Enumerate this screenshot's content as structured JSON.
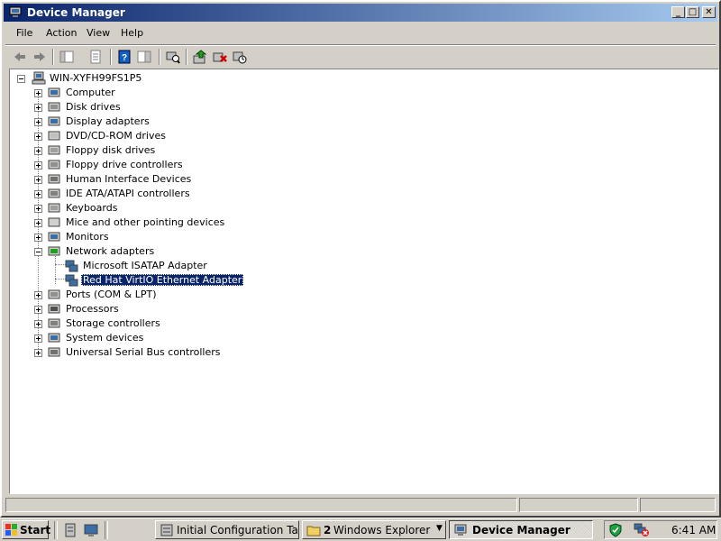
{
  "window": {
    "title": "Device Manager",
    "controls": {
      "minimize": "_",
      "maximize": "□",
      "close": "✕"
    }
  },
  "menu": [
    "File",
    "Action",
    "View",
    "Help"
  ],
  "toolbar": [
    "back-icon",
    "forward-icon",
    "show-hide-console-tree-icon",
    "properties-icon",
    "help-icon",
    "action-pane-icon",
    "scan-hardware-icon",
    "update-driver-icon",
    "uninstall-icon",
    "disable-device-icon"
  ],
  "tree": {
    "root": "WIN-XYFH99FS1P5",
    "categories": [
      {
        "label": "Computer",
        "icon": "computer-icon"
      },
      {
        "label": "Disk drives",
        "icon": "disk-drive-icon"
      },
      {
        "label": "Display adapters",
        "icon": "display-adapter-icon"
      },
      {
        "label": "DVD/CD-ROM drives",
        "icon": "dvd-drive-icon"
      },
      {
        "label": "Floppy disk drives",
        "icon": "floppy-drive-icon"
      },
      {
        "label": "Floppy drive controllers",
        "icon": "floppy-controller-icon"
      },
      {
        "label": "Human Interface Devices",
        "icon": "hid-icon"
      },
      {
        "label": "IDE ATA/ATAPI controllers",
        "icon": "ide-controller-icon"
      },
      {
        "label": "Keyboards",
        "icon": "keyboard-icon"
      },
      {
        "label": "Mice and other pointing devices",
        "icon": "mouse-icon"
      },
      {
        "label": "Monitors",
        "icon": "monitor-icon"
      },
      {
        "label": "Network adapters",
        "icon": "network-adapter-icon",
        "expanded": true,
        "children": [
          "Microsoft ISATAP Adapter",
          "Red Hat VirtIO Ethernet Adapter"
        ],
        "selected_child": 1
      },
      {
        "label": "Ports (COM & LPT)",
        "icon": "port-icon"
      },
      {
        "label": "Processors",
        "icon": "processor-icon"
      },
      {
        "label": "Storage controllers",
        "icon": "storage-controller-icon"
      },
      {
        "label": "System devices",
        "icon": "system-device-icon"
      },
      {
        "label": "Universal Serial Bus controllers",
        "icon": "usb-icon"
      }
    ]
  },
  "taskbar": {
    "start": "Start",
    "quick_launch": [
      "server-manager-icon",
      "show-desktop-icon"
    ],
    "tasks": [
      {
        "label": "Initial Configuration Tasks",
        "icon": "config-tasks-icon"
      },
      {
        "count": "2",
        "label": "Windows Explorer",
        "icon": "folder-icon"
      },
      {
        "label": "Device Manager",
        "icon": "device-manager-icon",
        "active": true
      }
    ],
    "tray_icons": [
      "security-shield-icon",
      "network-disconnected-icon"
    ],
    "clock": "6:41 AM"
  }
}
